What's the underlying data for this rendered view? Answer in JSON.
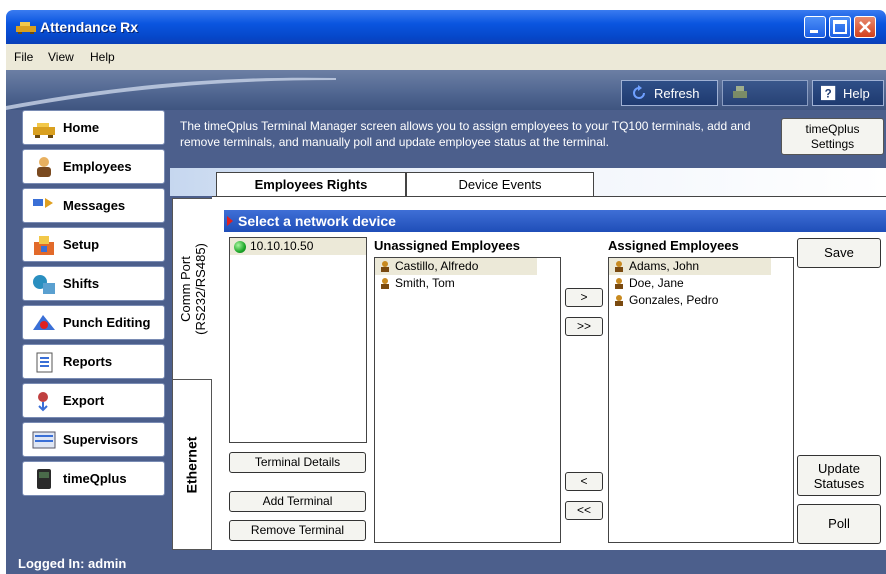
{
  "window": {
    "title": "Attendance Rx"
  },
  "menu": [
    "File",
    "View",
    "Help"
  ],
  "toolbar": {
    "refresh": "Refresh",
    "help": "Help"
  },
  "nav": [
    {
      "label": "Home",
      "icon": "home-icon"
    },
    {
      "label": "Employees",
      "icon": "employees-icon"
    },
    {
      "label": "Messages",
      "icon": "messages-icon"
    },
    {
      "label": "Setup",
      "icon": "setup-icon"
    },
    {
      "label": "Shifts",
      "icon": "shifts-icon"
    },
    {
      "label": "Punch Editing",
      "icon": "punch-editing-icon"
    },
    {
      "label": "Reports",
      "icon": "reports-icon"
    },
    {
      "label": "Export",
      "icon": "export-icon"
    },
    {
      "label": "Supervisors",
      "icon": "supervisors-icon"
    },
    {
      "label": "timeQplus",
      "icon": "timeqplus-icon"
    }
  ],
  "info": {
    "text": "The timeQplus Terminal Manager screen allows you to assign employees to your TQ100 terminals, add and remove terminals, and manually poll and update employee status at the terminal.",
    "settings_label_1": "timeQplus",
    "settings_label_2": "Settings"
  },
  "tabs": {
    "employees_rights": "Employees Rights",
    "device_events": "Device Events"
  },
  "side_tabs": {
    "comm_port_1": "Comm Port",
    "comm_port_2": "(RS232/RS485)",
    "ethernet": "Ethernet"
  },
  "section": {
    "title": "Select a network device"
  },
  "devices": [
    "10.10.10.50"
  ],
  "unassigned": {
    "header": "Unassigned Employees",
    "items": [
      "Castillo, Alfredo",
      "Smith, Tom"
    ]
  },
  "assigned": {
    "header": "Assigned Employees",
    "items": [
      "Adams, John",
      "Doe, Jane",
      "Gonzales, Pedro"
    ]
  },
  "transfer": {
    "add_one": ">",
    "add_all": ">>",
    "remove_one": "<",
    "remove_all": "<<"
  },
  "buttons": {
    "terminal_details": "Terminal Details",
    "add_terminal": "Add Terminal",
    "remove_terminal": "Remove Terminal",
    "save": "Save",
    "update_statuses_1": "Update",
    "update_statuses_2": "Statuses",
    "poll": "Poll"
  },
  "status": {
    "logged_in": "Logged In: admin"
  }
}
